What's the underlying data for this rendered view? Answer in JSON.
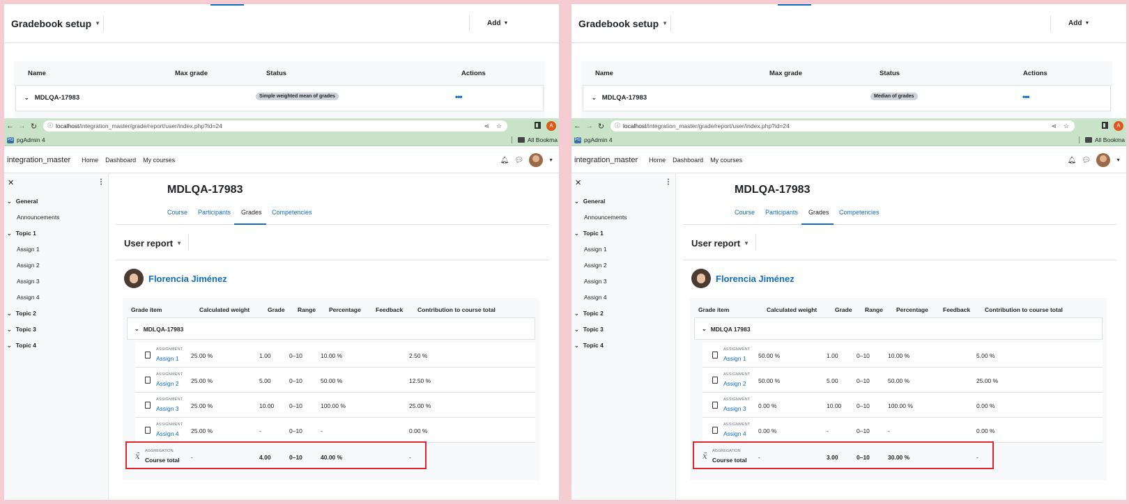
{
  "colors": {
    "accent": "#0f6cbf",
    "highlight": "#e0262a",
    "browser_bar": "#c8e3c8",
    "background": "#f6ccd3"
  },
  "panels": [
    {
      "gradebook": {
        "title": "Gradebook setup",
        "add_label": "Add",
        "headers": [
          "Name",
          "Max grade",
          "Status",
          "Actions"
        ],
        "category": "MDLQA-17983",
        "status_badge": "Simple weighted mean of grades",
        "actions_icon": "more-dots-icon"
      },
      "browser": {
        "url_host": "localhost",
        "url_path": "/integration_master/grade/report/user/index.php?id=24",
        "profile_initial": "A",
        "bookmark": "pgAdmin 4",
        "bookmarks_folder": "All Bookma"
      },
      "nav": {
        "site": "integration_master",
        "links": [
          "Home",
          "Dashboard",
          "My courses"
        ]
      },
      "course_index": {
        "sections": [
          "General",
          "Topic 1",
          "Topic 2",
          "Topic 3",
          "Topic 4"
        ],
        "activities": [
          "Announcements",
          "Assign 1",
          "Assign 2",
          "Assign 3",
          "Assign 4"
        ]
      },
      "course": {
        "title": "MDLQA-17983",
        "tabs": [
          "Course",
          "Participants",
          "Grades",
          "Competencies"
        ],
        "active_tab": "Grades",
        "report_title": "User report",
        "user_name": "Florencia Jiménez"
      },
      "report": {
        "headers": [
          "Grade item",
          "Calculated weight",
          "Grade",
          "Range",
          "Percentage",
          "Feedback",
          "Contribution to course total"
        ],
        "category": "MDLQA-17983",
        "items": [
          {
            "type": "ASSIGNMENT",
            "name": "Assign 1",
            "weight": "25.00 %",
            "grade": "1.00",
            "range": "0–10",
            "percentage": "10.00 %",
            "feedback": "",
            "contribution": "2.50 %"
          },
          {
            "type": "ASSIGNMENT",
            "name": "Assign 2",
            "weight": "25.00 %",
            "grade": "5.00",
            "range": "0–10",
            "percentage": "50.00 %",
            "feedback": "",
            "contribution": "12.50 %"
          },
          {
            "type": "ASSIGNMENT",
            "name": "Assign 3",
            "weight": "25.00 %",
            "grade": "10.00",
            "range": "0–10",
            "percentage": "100.00 %",
            "feedback": "",
            "contribution": "25.00 %"
          },
          {
            "type": "ASSIGNMENT",
            "name": "Assign 4",
            "weight": "25.00 %",
            "grade": "-",
            "range": "0–10",
            "percentage": "-",
            "feedback": "",
            "contribution": "0.00 %"
          }
        ],
        "total": {
          "type": "AGGREGATION",
          "name": "Course total",
          "weight": "-",
          "grade": "4.00",
          "range": "0–10",
          "percentage": "40.00 %",
          "feedback": "",
          "contribution": "-"
        }
      }
    },
    {
      "gradebook": {
        "title": "Gradebook setup",
        "add_label": "Add",
        "headers": [
          "Name",
          "Max grade",
          "Status",
          "Actions"
        ],
        "category": "MDLQA-17983",
        "status_badge": "Median of grades",
        "actions_icon": "more-dots-icon"
      },
      "browser": {
        "url_host": "localhost",
        "url_path": "/integration_master/grade/report/user/index.php?id=24",
        "profile_initial": "A",
        "bookmark": "pgAdmin 4",
        "bookmarks_folder": "All Bookma"
      },
      "nav": {
        "site": "integration_master",
        "links": [
          "Home",
          "Dashboard",
          "My courses"
        ]
      },
      "course_index": {
        "sections": [
          "General",
          "Topic 1",
          "Topic 2",
          "Topic 3",
          "Topic 4"
        ],
        "activities": [
          "Announcements",
          "Assign 1",
          "Assign 2",
          "Assign 3",
          "Assign 4"
        ]
      },
      "course": {
        "title": "MDLQA-17983",
        "tabs": [
          "Course",
          "Participants",
          "Grades",
          "Competencies"
        ],
        "active_tab": "Grades",
        "report_title": "User report",
        "user_name": "Florencia Jiménez"
      },
      "report": {
        "headers": [
          "Grade item",
          "Calculated weight",
          "Grade",
          "Range",
          "Percentage",
          "Feedback",
          "Contribution to course total"
        ],
        "category": "MDLQA 17983",
        "items": [
          {
            "type": "ASSIGNMENT",
            "name": "Assign 1",
            "weight": "50.00 %",
            "grade": "1.00",
            "range": "0–10",
            "percentage": "10.00 %",
            "feedback": "",
            "contribution": "5.00 %"
          },
          {
            "type": "ASSIGNMENT",
            "name": "Assign 2",
            "weight": "50.00 %",
            "grade": "5.00",
            "range": "0–10",
            "percentage": "50.00 %",
            "feedback": "",
            "contribution": "25.00 %"
          },
          {
            "type": "ASSIGNMENT",
            "name": "Assign 3",
            "weight": "0.00 %",
            "grade": "10.00",
            "range": "0–10",
            "percentage": "100.00 %",
            "feedback": "",
            "contribution": "0.00 %"
          },
          {
            "type": "ASSIGNMENT",
            "name": "Assign 4",
            "weight": "0.00 %",
            "grade": "-",
            "range": "0–10",
            "percentage": "-",
            "feedback": "",
            "contribution": "0.00 %"
          }
        ],
        "total": {
          "type": "AGGREGATION",
          "name": "Course total",
          "weight": "-",
          "grade": "3.00",
          "range": "0–10",
          "percentage": "30.00 %",
          "feedback": "",
          "contribution": "-"
        }
      }
    }
  ]
}
